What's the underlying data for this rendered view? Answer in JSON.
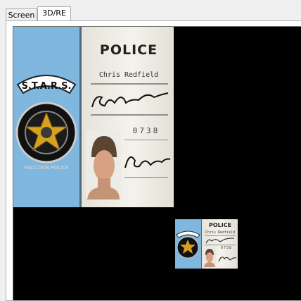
{
  "tabs": [
    {
      "label": "Screen",
      "active": false
    },
    {
      "label": "3D/RE",
      "active": true
    }
  ],
  "id_card": {
    "header": "POLICE",
    "name": "Chris Redfield",
    "id_number": "0738",
    "emblem_text": "S.T.A.R.S.",
    "emblem_subtext": "RACCOON POLICE"
  },
  "colors": {
    "viewport_bg": "#000000",
    "card_blue": "#7fb7df",
    "card_paper": "#f3f2ec",
    "emblem_gold": "#d6a11e"
  }
}
